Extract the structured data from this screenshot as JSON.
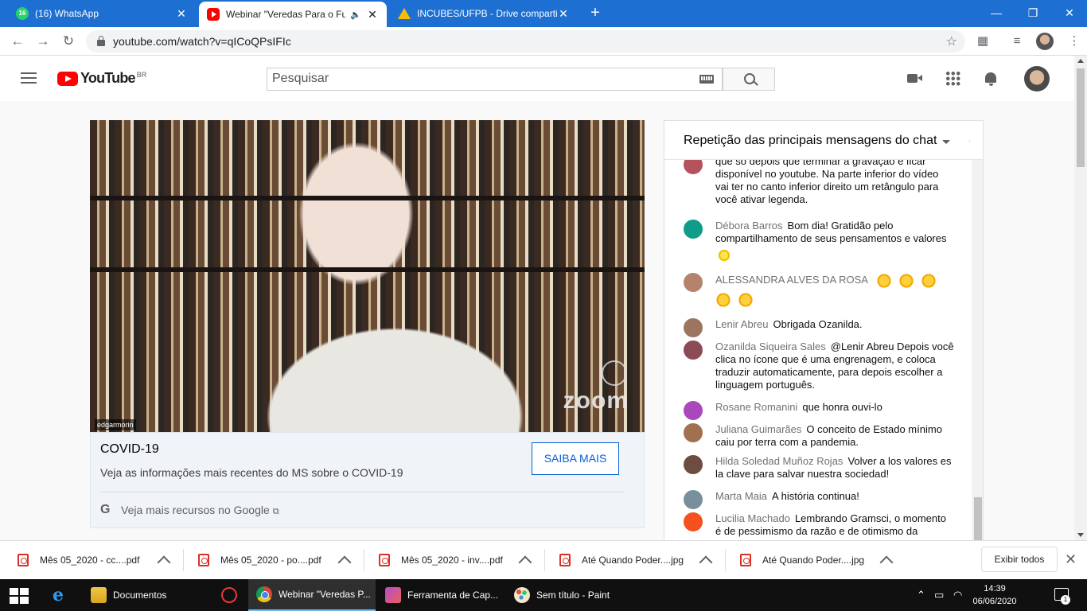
{
  "browser": {
    "tabs": [
      {
        "title": "(16) WhatsApp",
        "badge": "16"
      },
      {
        "title": "Webinar \"Veredas Para o Futuro\""
      },
      {
        "title": "INCUBES/UFPB - Drive compartilhado"
      }
    ],
    "url": "youtube.com/watch?v=qICoQPsIFIc"
  },
  "youtube": {
    "logo_text": "YouTube",
    "country_code": "BR",
    "search_placeholder": "Pesquisar"
  },
  "video": {
    "participant_name": "edgarmorin",
    "watermark": "zoom"
  },
  "info_card": {
    "title": "COVID-19",
    "description": "Veja as informações mais recentes do MS sobre o COVID-19",
    "button_label": "SAIBA MAIS",
    "google_link": "Veja mais recursos no Google"
  },
  "chat": {
    "header": "Repetição das principais mensagens do chat",
    "messages": [
      {
        "author": "",
        "text": "que só depois que terminar a gravação e ficar disponível no youtube. Na parte inferior do vídeo vai ter no canto inferior direito um retângulo para você ativar legenda.",
        "avatar_color": "#b5525d"
      },
      {
        "author": "Débora Barros",
        "text": "Bom dia! Gratidão pelo compartilhamento de seus pensamentos e valores",
        "avatar_color": "#0f9d8a"
      },
      {
        "author": "ALESSANDRA ALVES DA ROSA",
        "text": "",
        "avatar_color": "#b5826d"
      },
      {
        "author": "Lenir Abreu",
        "text": "Obrigada Ozanilda.",
        "avatar_color": "#9b7560"
      },
      {
        "author": "Ozanilda Siqueira Sales",
        "text": "@Lenir Abreu Depois você clica no ícone que é uma engrenagem, e coloca traduzir automaticamente, para depois escolher a linguagem português.",
        "avatar_color": "#8a4b55"
      },
      {
        "author": "Rosane Romanini",
        "text": "que honra ouvi-lo",
        "avatar_color": "#ab47bc"
      },
      {
        "author": "Juliana Guimarães",
        "text": "O conceito de Estado mínimo caiu por terra com a pandemia.",
        "avatar_color": "#a07050"
      },
      {
        "author": "Hilda Soledad Muñoz Rojas",
        "text": "Volver a los valores es la clave para salvar nuestra sociedad!",
        "avatar_color": "#6d4c41"
      },
      {
        "author": "Marta Maia",
        "text": "A história continua!",
        "avatar_color": "#78909c"
      },
      {
        "author": "Lucilia Machado",
        "text": "Lembrando Gramsci, o momento é de pessimismo da razão e de otimismo da",
        "avatar_color": "#f4511e"
      }
    ]
  },
  "downloads": {
    "items": [
      {
        "name": "Mês 05_2020 - cc....pdf"
      },
      {
        "name": "Mês 05_2020 - po....pdf"
      },
      {
        "name": "Mês 05_2020 - inv....pdf"
      },
      {
        "name": "Até Quando Poder....jpg"
      },
      {
        "name": "Até Quando Poder....jpg"
      }
    ],
    "show_all": "Exibir todos"
  },
  "taskbar": {
    "items": [
      {
        "label": "Documentos"
      },
      {
        "label": "Webinar \"Veredas P..."
      },
      {
        "label": "Ferramenta de Cap..."
      },
      {
        "label": "Sem título - Paint"
      }
    ],
    "time": "14:39",
    "date": "06/06/2020",
    "notification_count": "1"
  }
}
